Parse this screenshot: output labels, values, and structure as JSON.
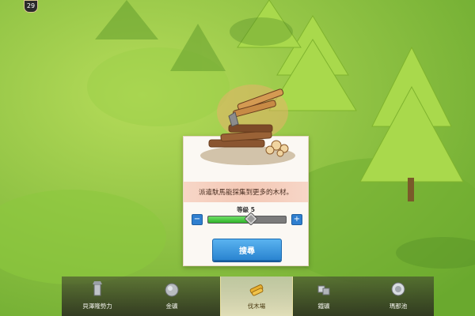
{
  "hud": {
    "level_badge": "29"
  },
  "dialog": {
    "description": "派遣馱馬能採集到更多的木材。",
    "level_label": "等級 5",
    "slider": {
      "value": 5,
      "min": 1,
      "max": 10,
      "fraction": 0.55
    },
    "decrement_label": "−",
    "increment_label": "+",
    "search_button": "搜尋"
  },
  "bottom_nav": {
    "items": [
      {
        "label": "貝澤隆勢力",
        "icon": "tower-icon",
        "active": false
      },
      {
        "label": "金礦",
        "icon": "gold-ore-icon",
        "active": false
      },
      {
        "label": "伐木場",
        "icon": "lumber-icon",
        "active": true
      },
      {
        "label": "鐵礦",
        "icon": "iron-ore-icon",
        "active": false
      },
      {
        "label": "瑪那池",
        "icon": "mana-pool-icon",
        "active": false
      }
    ]
  },
  "colors": {
    "grass": "#7fbf3a",
    "tree": "#a6d84a",
    "accent_blue": "#2a84d0",
    "slider_green": "#2fb32a"
  }
}
